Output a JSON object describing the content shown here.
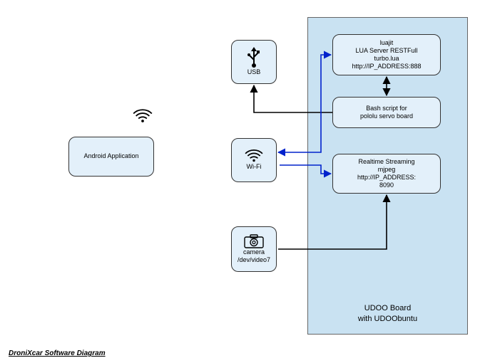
{
  "caption": "DroniXcar Software Diagram",
  "udoo": {
    "title_line1": "UDOO Board",
    "title_line2": "with UDOObuntu"
  },
  "nodes": {
    "android": {
      "label": "Android Application"
    },
    "usb": {
      "label": "USB"
    },
    "wifi": {
      "label": "Wi-Fi"
    },
    "camera": {
      "line1": "camera",
      "line2": "/dev/video7"
    },
    "lua": {
      "line1": "luajit",
      "line2": "LUA Server RESTFull",
      "line3": "turbo.lua",
      "line4": "http://IP_ADDRESS:888"
    },
    "bash": {
      "line1": "Bash script for",
      "line2": "pololu servo board"
    },
    "stream": {
      "line1": "Realtime Streaming",
      "line2": "mjpeg",
      "line3": "http://IP_ADDRESS:",
      "line4": "8090"
    }
  },
  "icons": {
    "usb": "usb-icon",
    "wifi": "wifi-icon",
    "camera": "camera-icon",
    "wifi_free": "wifi-icon"
  },
  "colors": {
    "node_fill": "#e3f0fa",
    "container_fill": "#c9e2f2",
    "wire_black": "#000000",
    "wire_blue": "#0022cc"
  }
}
